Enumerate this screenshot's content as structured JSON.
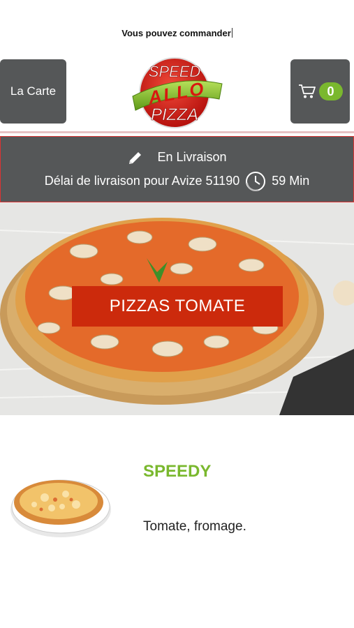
{
  "status_text": "Vous pouvez commander",
  "header": {
    "menu_label": "La Carte",
    "cart_count": "0",
    "logo": {
      "top": "SPEED",
      "middle": "ALLO",
      "bottom": "PIZZA"
    }
  },
  "delivery": {
    "mode": "En Livraison",
    "delay_text": "Délai de livraison pour Avize 51190",
    "time": "59 Min"
  },
  "category": {
    "label": "PIZZAS TOMATE"
  },
  "products": [
    {
      "name": "SPEEDY",
      "description": "Tomate, fromage."
    }
  ],
  "colors": {
    "accent_green": "#7ab82e",
    "category_red": "#cc2a0c",
    "header_gray": "#555758"
  }
}
